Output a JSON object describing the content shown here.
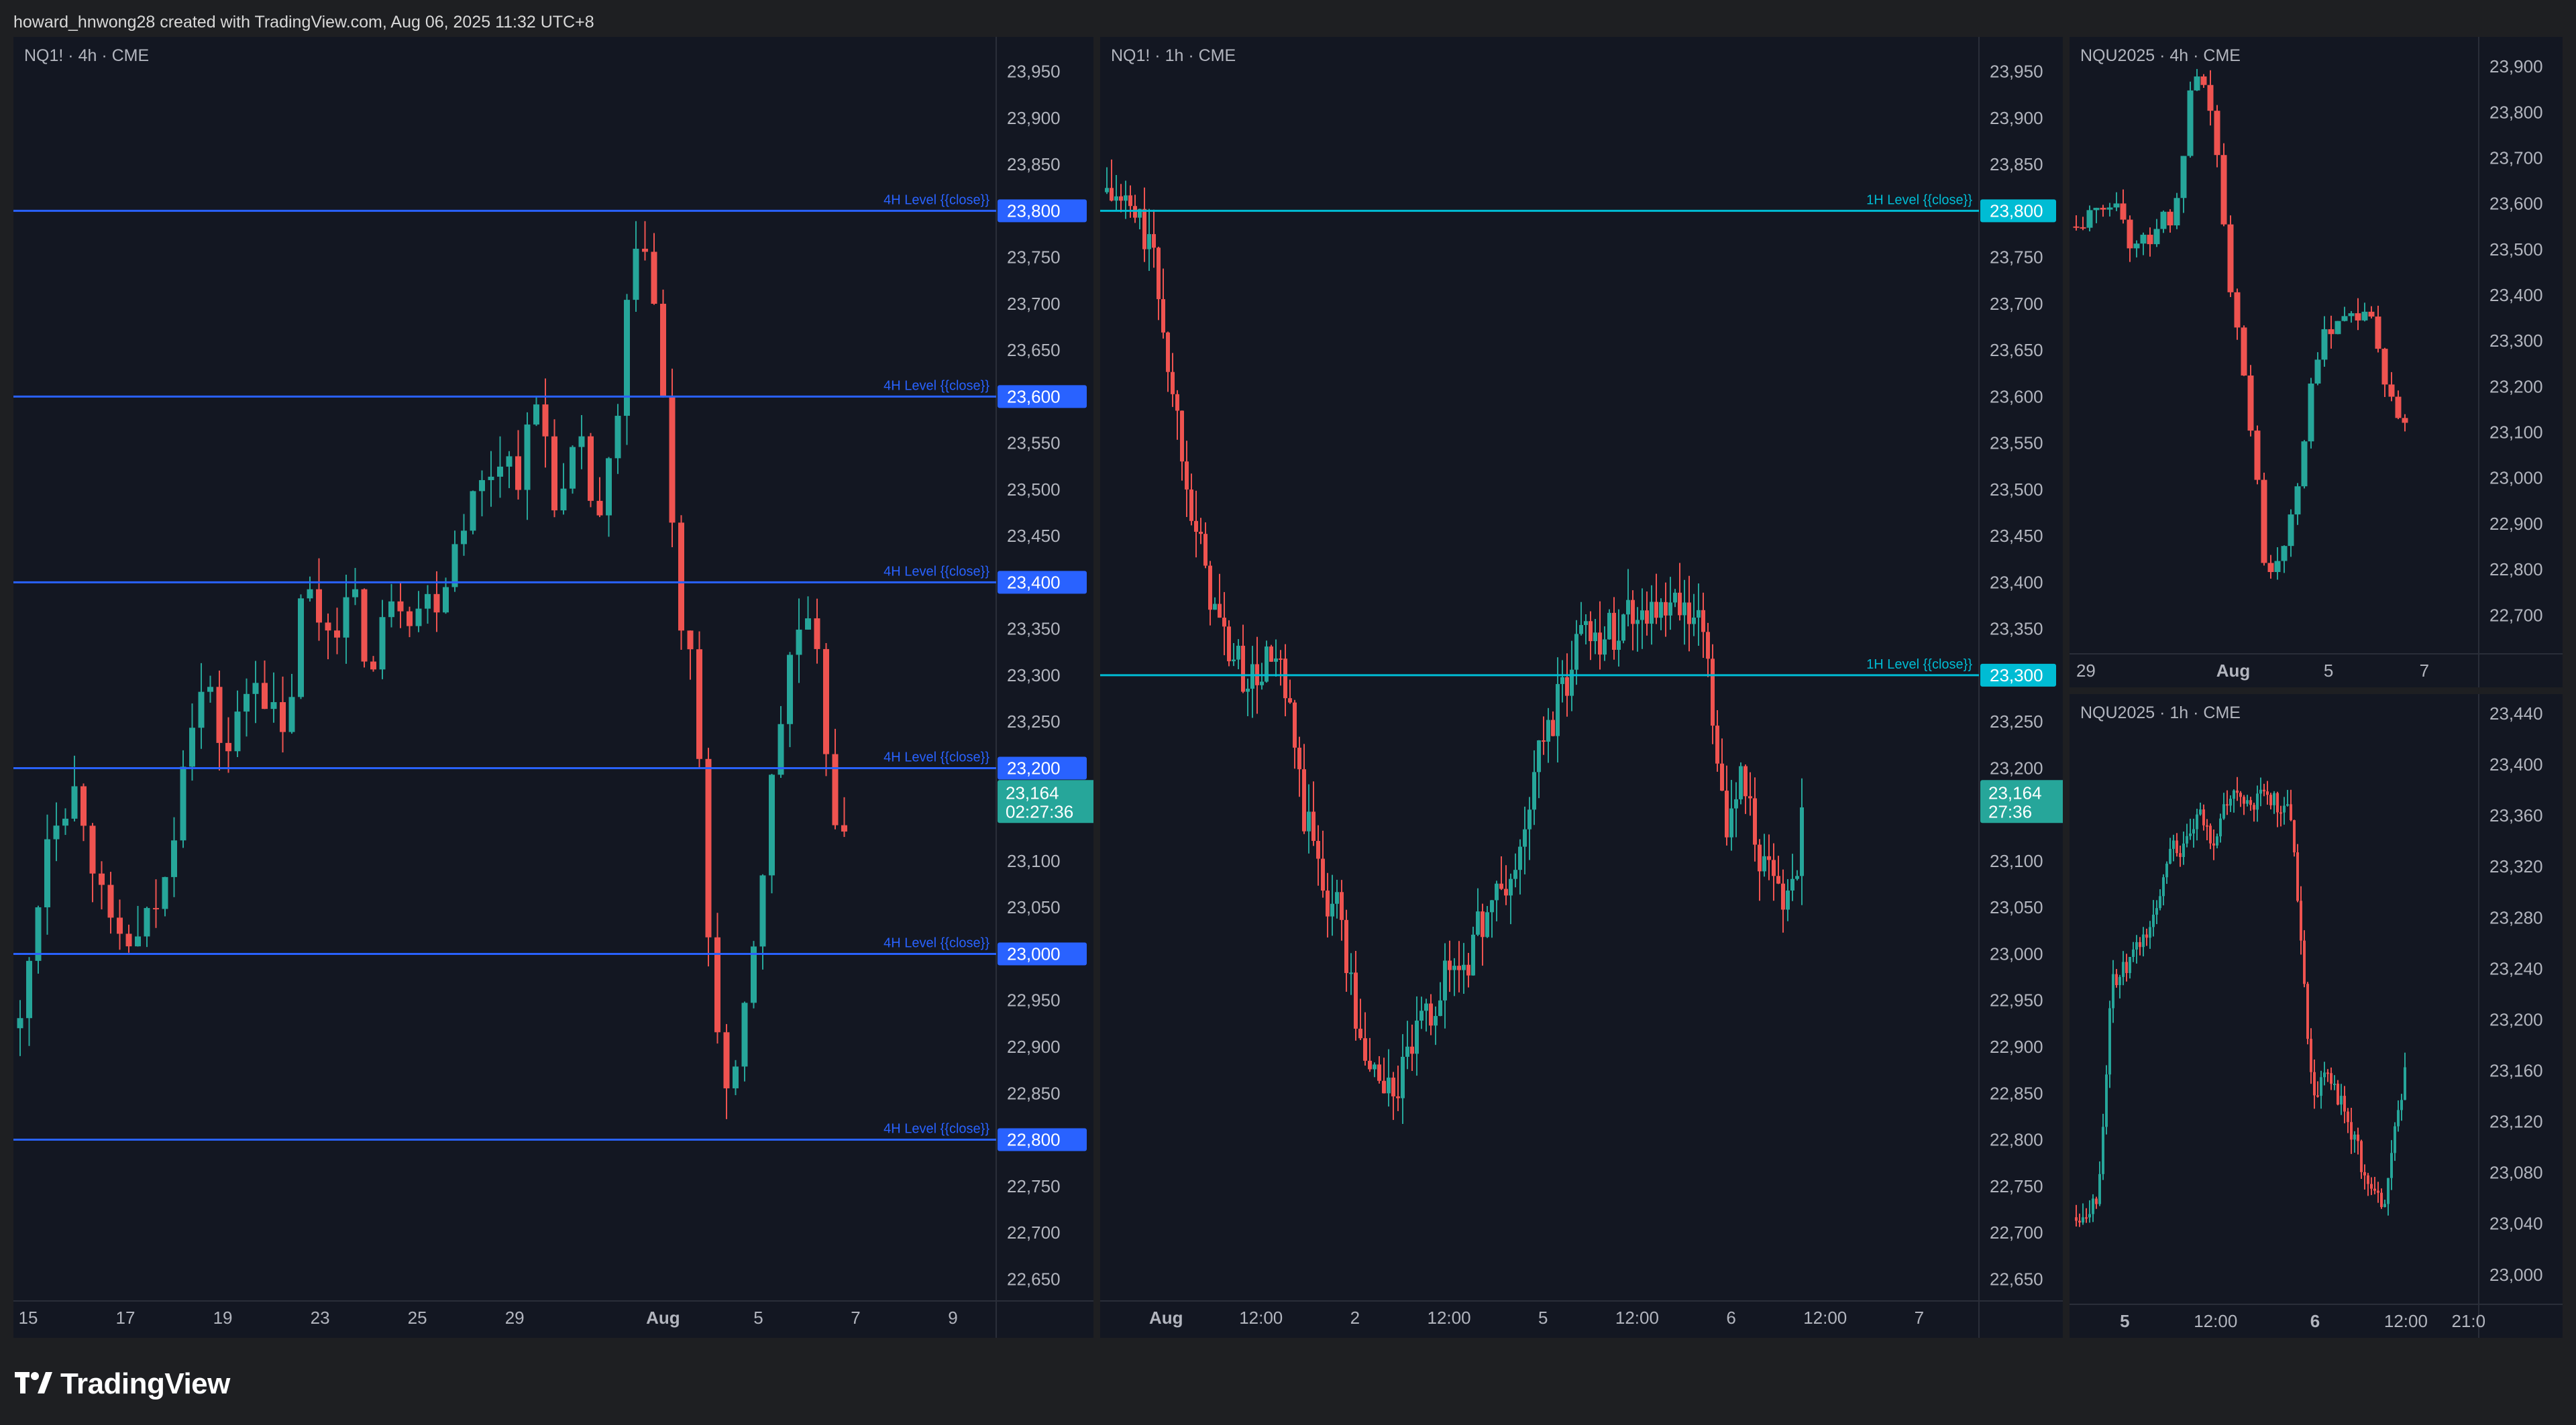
{
  "header": {
    "text": "howard_hnwong28 created with TradingView.com, Aug 06, 2025 11:32 UTC+8"
  },
  "footer": {
    "brand": "TradingView"
  },
  "colors": {
    "bull": "#26a69a",
    "bear": "#ef5350",
    "level_4h": "#2962ff",
    "level_1h": "#00bcd4",
    "price_tag": "#26a69a",
    "panel_bg": "#131722",
    "axis_text": "#b2b5be",
    "grid": "#2a2e39"
  },
  "chart_data": [
    {
      "id": "nq-4h",
      "type": "candlestick",
      "title": "NQ1! · 4h · CME",
      "ylim": [
        22630,
        23980
      ],
      "y_ticks": [
        23950,
        23900,
        23850,
        23800,
        23750,
        23700,
        23650,
        23600,
        23550,
        23500,
        23450,
        23400,
        23350,
        23300,
        23250,
        23200,
        23150,
        23100,
        23050,
        23000,
        22950,
        22900,
        22850,
        22800,
        22750,
        22700,
        22650
      ],
      "x_ticks": [
        {
          "label": "15",
          "frac": 0.015
        },
        {
          "label": "17",
          "frac": 0.114
        },
        {
          "label": "19",
          "frac": 0.213
        },
        {
          "label": "23",
          "frac": 0.312
        },
        {
          "label": "25",
          "frac": 0.411
        },
        {
          "label": "29",
          "frac": 0.51
        },
        {
          "label": "Aug",
          "frac": 0.661,
          "bold": true
        },
        {
          "label": "5",
          "frac": 0.758
        },
        {
          "label": "7",
          "frac": 0.857
        },
        {
          "label": "9",
          "frac": 0.956
        }
      ],
      "x_span": [
        0,
        99
      ],
      "levels": [
        {
          "price": 23800,
          "label": "4H Level {{close}}",
          "tag": "23,800"
        },
        {
          "price": 23600,
          "label": "4H Level {{close}}",
          "tag": "23,600"
        },
        {
          "price": 23400,
          "label": "4H Level {{close}}",
          "tag": "23,400"
        },
        {
          "price": 23200,
          "label": "4H Level {{close}}",
          "tag": "23,200"
        },
        {
          "price": 23000,
          "label": "4H Level {{close}}",
          "tag": "23,000"
        },
        {
          "price": 22800,
          "label": "4H Level {{close}}",
          "tag": "22,800"
        }
      ],
      "level_style": "4h",
      "last_price": {
        "price": 23164,
        "line1": "23,164",
        "line2": "02:27:36"
      },
      "anchors": [
        [
          0,
          22920
        ],
        [
          3,
          23150
        ],
        [
          6,
          23180
        ],
        [
          9,
          23020
        ],
        [
          12,
          23010
        ],
        [
          15,
          23080
        ],
        [
          17,
          23250
        ],
        [
          19,
          23290
        ],
        [
          21,
          23210
        ],
        [
          24,
          23310
        ],
        [
          27,
          23220
        ],
        [
          29,
          23400
        ],
        [
          31,
          23350
        ],
        [
          34,
          23380
        ],
        [
          36,
          23300
        ],
        [
          38,
          23400
        ],
        [
          40,
          23370
        ],
        [
          43,
          23390
        ],
        [
          45,
          23470
        ],
        [
          47,
          23500
        ],
        [
          49,
          23540
        ],
        [
          51,
          23520
        ],
        [
          53,
          23600
        ],
        [
          55,
          23470
        ],
        [
          57,
          23550
        ],
        [
          59,
          23460
        ],
        [
          61,
          23560
        ],
        [
          62,
          23700
        ],
        [
          64,
          23780
        ],
        [
          66,
          23560
        ],
        [
          67,
          23380
        ],
        [
          69,
          23280
        ],
        [
          70,
          23050
        ],
        [
          72,
          22850
        ],
        [
          73,
          22850
        ],
        [
          75,
          23020
        ],
        [
          77,
          23200
        ],
        [
          79,
          23350
        ],
        [
          81,
          23340
        ],
        [
          82,
          23250
        ],
        [
          84,
          23100
        ],
        [
          85,
          23160
        ]
      ]
    },
    {
      "id": "nq-1h",
      "type": "candlestick",
      "title": "NQ1! · 1h · CME",
      "ylim": [
        22630,
        23980
      ],
      "y_ticks": [
        23950,
        23900,
        23850,
        23800,
        23750,
        23700,
        23650,
        23600,
        23550,
        23500,
        23450,
        23400,
        23350,
        23300,
        23250,
        23200,
        23150,
        23100,
        23050,
        23000,
        22950,
        22900,
        22850,
        22800,
        22750,
        22700,
        22650
      ],
      "x_ticks": [
        {
          "label": "Aug",
          "frac": 0.075,
          "bold": true
        },
        {
          "label": "12:00",
          "frac": 0.183
        },
        {
          "label": "2",
          "frac": 0.29
        },
        {
          "label": "12:00",
          "frac": 0.397
        },
        {
          "label": "5",
          "frac": 0.504
        },
        {
          "label": "12:00",
          "frac": 0.611
        },
        {
          "label": "6",
          "frac": 0.718
        },
        {
          "label": "12:00",
          "frac": 0.825
        },
        {
          "label": "7",
          "frac": 0.932
        }
      ],
      "x_span": [
        0,
        145
      ],
      "levels": [
        {
          "price": 23800,
          "label": "1H Level {{close}}",
          "tag": "23,800"
        },
        {
          "price": 23300,
          "label": "1H Level {{close}}",
          "tag": "23,300"
        }
      ],
      "level_style": "1h",
      "last_price": {
        "price": 23164,
        "line1": "23,164",
        "line2": "27:36"
      },
      "anchors": [
        [
          0,
          23820
        ],
        [
          4,
          23800
        ],
        [
          7,
          23770
        ],
        [
          9,
          23700
        ],
        [
          11,
          23600
        ],
        [
          13,
          23540
        ],
        [
          15,
          23450
        ],
        [
          17,
          23400
        ],
        [
          19,
          23350
        ],
        [
          21,
          23320
        ],
        [
          23,
          23300
        ],
        [
          25,
          23290
        ],
        [
          27,
          23320
        ],
        [
          29,
          23300
        ],
        [
          31,
          23240
        ],
        [
          33,
          23150
        ],
        [
          35,
          23110
        ],
        [
          37,
          23060
        ],
        [
          39,
          23050
        ],
        [
          41,
          22960
        ],
        [
          43,
          22880
        ],
        [
          45,
          22880
        ],
        [
          47,
          22850
        ],
        [
          49,
          22860
        ],
        [
          51,
          22900
        ],
        [
          53,
          22920
        ],
        [
          55,
          22950
        ],
        [
          57,
          22980
        ],
        [
          59,
          22990
        ],
        [
          61,
          23000
        ],
        [
          63,
          23040
        ],
        [
          65,
          23060
        ],
        [
          67,
          23070
        ],
        [
          69,
          23100
        ],
        [
          71,
          23170
        ],
        [
          73,
          23230
        ],
        [
          75,
          23260
        ],
        [
          77,
          23290
        ],
        [
          79,
          23350
        ],
        [
          81,
          23360
        ],
        [
          83,
          23340
        ],
        [
          85,
          23350
        ],
        [
          87,
          23370
        ],
        [
          89,
          23370
        ],
        [
          91,
          23380
        ],
        [
          93,
          23360
        ],
        [
          95,
          23370
        ],
        [
          97,
          23360
        ],
        [
          99,
          23350
        ],
        [
          101,
          23320
        ],
        [
          102,
          23190
        ],
        [
          104,
          23140
        ],
        [
          106,
          23200
        ],
        [
          108,
          23150
        ],
        [
          110,
          23090
        ],
        [
          112,
          23070
        ],
        [
          114,
          23060
        ],
        [
          116,
          23110
        ],
        [
          117,
          23164
        ]
      ]
    },
    {
      "id": "nqu-4h",
      "type": "candlestick",
      "title": "NQU2025 · 4h · CME",
      "ylim": [
        22630,
        23950
      ],
      "y_ticks": [
        23900,
        23800,
        23700,
        23600,
        23500,
        23400,
        23300,
        23200,
        23100,
        23000,
        22900,
        22800,
        22700
      ],
      "x_ticks": [
        {
          "label": "29",
          "frac": 0.04
        },
        {
          "label": "Aug",
          "frac": 0.4,
          "bold": true
        },
        {
          "label": "5",
          "frac": 0.633
        },
        {
          "label": "7",
          "frac": 0.867
        }
      ],
      "x_span": [
        0,
        52
      ],
      "levels": [],
      "last_price": null,
      "anchors": [
        [
          0,
          23550
        ],
        [
          3,
          23580
        ],
        [
          5,
          23620
        ],
        [
          7,
          23520
        ],
        [
          9,
          23510
        ],
        [
          11,
          23570
        ],
        [
          13,
          23560
        ],
        [
          15,
          23830
        ],
        [
          16,
          23860
        ],
        [
          18,
          23800
        ],
        [
          19,
          23620
        ],
        [
          20,
          23420
        ],
        [
          22,
          23250
        ],
        [
          24,
          22950
        ],
        [
          25,
          22780
        ],
        [
          27,
          22850
        ],
        [
          29,
          22990
        ],
        [
          31,
          23200
        ],
        [
          33,
          23330
        ],
        [
          35,
          23360
        ],
        [
          37,
          23360
        ],
        [
          39,
          23340
        ],
        [
          41,
          23170
        ],
        [
          43,
          23110
        ],
        [
          44,
          23164
        ]
      ]
    },
    {
      "id": "nqu-1h",
      "type": "candlestick",
      "title": "NQU2025 · 1h · CME",
      "ylim": [
        22982,
        23450
      ],
      "y_ticks": [
        23440,
        23400,
        23360,
        23320,
        23280,
        23240,
        23200,
        23160,
        23120,
        23080,
        23040,
        23000
      ],
      "x_ticks": [
        {
          "label": "5",
          "frac": 0.135,
          "bold": true
        },
        {
          "label": "12:00",
          "frac": 0.357
        },
        {
          "label": "6",
          "frac": 0.6,
          "bold": true
        },
        {
          "label": "12:00",
          "frac": 0.822
        },
        {
          "label": "21:0",
          "frac": 0.975
        }
      ],
      "x_span": [
        0,
        110
      ],
      "levels": [],
      "last_price": null,
      "anchors": [
        [
          0,
          23045
        ],
        [
          6,
          23060
        ],
        [
          10,
          23230
        ],
        [
          14,
          23240
        ],
        [
          18,
          23260
        ],
        [
          22,
          23280
        ],
        [
          26,
          23340
        ],
        [
          30,
          23330
        ],
        [
          34,
          23360
        ],
        [
          38,
          23340
        ],
        [
          42,
          23370
        ],
        [
          46,
          23380
        ],
        [
          48,
          23360
        ],
        [
          52,
          23380
        ],
        [
          56,
          23370
        ],
        [
          60,
          23360
        ],
        [
          64,
          23200
        ],
        [
          66,
          23140
        ],
        [
          70,
          23160
        ],
        [
          74,
          23130
        ],
        [
          78,
          23100
        ],
        [
          82,
          23060
        ],
        [
          86,
          23060
        ],
        [
          88,
          23100
        ],
        [
          90,
          23140
        ],
        [
          92,
          23164
        ]
      ]
    }
  ]
}
